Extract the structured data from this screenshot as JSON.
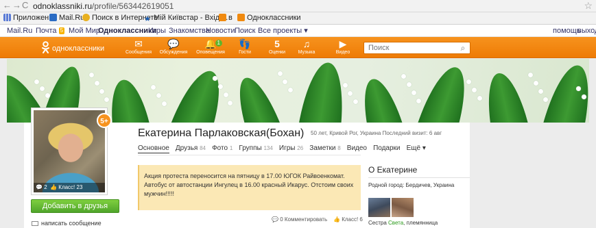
{
  "browser": {
    "back": "←",
    "forward": "→",
    "reload": "C",
    "url_host": "odnoklassniki.ru",
    "url_path": "/profile/563442619051",
    "star": "☆"
  },
  "bookmarks": [
    {
      "label": "Приложения",
      "color": "#5a7bd6"
    },
    {
      "label": "Mail.Ru",
      "color": "#2b6cc4"
    },
    {
      "label": "Поиск в Интернете",
      "color": "#e8b020"
    },
    {
      "label": "Мій Київстар - Вхід ...",
      "color": "#1a5fb4"
    },
    {
      "label": "в",
      "color": "#f08a10"
    },
    {
      "label": "Одноклассники",
      "color": "#f08a10"
    }
  ],
  "portal": {
    "links": [
      "Mail.Ru",
      "Почта",
      "Мой Мир",
      "Одноклассники",
      "Игры",
      "Знакомства",
      "Новости",
      "Поиск",
      "Все проекты ▾"
    ],
    "mail_count": "5",
    "help": "помощь",
    "logout": "выход"
  },
  "toolbar": {
    "logo_text": "одноклассники",
    "items": [
      {
        "label": "Сообщения",
        "icon": "envelope-icon",
        "glyph": "✉"
      },
      {
        "label": "Обсуждения",
        "icon": "chat-icon",
        "glyph": "💬"
      },
      {
        "label": "Оповещения",
        "icon": "bell-icon",
        "glyph": "🔔",
        "badge": "1"
      },
      {
        "label": "Гости",
        "icon": "footprints-icon",
        "glyph": "👣"
      },
      {
        "label": "Оценки",
        "icon": "rating-icon",
        "glyph": "5"
      },
      {
        "label": "Музыка",
        "icon": "music-icon",
        "glyph": "♫"
      },
      {
        "label": "Видео",
        "icon": "video-icon",
        "glyph": "▶"
      }
    ],
    "search_placeholder": "Поиск"
  },
  "colors": {
    "accent": "#f7931e",
    "green": "#5fb52b",
    "notice_bg": "#fbe8b5"
  },
  "profile": {
    "name": "Екатерина Парлаковская(Бохан)",
    "meta": "50 лет, Кривой Рог, Украина  Последний визит: 6 авг",
    "photo_comments": "2",
    "photo_likes": "Класс! 23",
    "badge": "5+",
    "add_friend": "Добавить в друзья",
    "write_message": "написать сообщение"
  },
  "tabs": [
    {
      "label": "Основное",
      "count": ""
    },
    {
      "label": "Друзья",
      "count": "84"
    },
    {
      "label": "Фото",
      "count": "1"
    },
    {
      "label": "Группы",
      "count": "134"
    },
    {
      "label": "Игры",
      "count": "26"
    },
    {
      "label": "Заметки",
      "count": "8"
    },
    {
      "label": "Видео",
      "count": ""
    },
    {
      "label": "Подарки",
      "count": ""
    },
    {
      "label": "Ещё ▾",
      "count": ""
    }
  ],
  "notice": {
    "text": "Акция протеста переносится на  пятницу  в 17.00  ЮГОК Райвоенкомат. Автобус от автостанции Ингулец в 16.00 красный Икарус. Отстоим своих мужчин!!!!!",
    "comments": "0 Комментировать",
    "likes": "Класс! 6"
  },
  "about": {
    "title": "О Екатерине",
    "city": "Родной город: Бердичев, Украина",
    "relative_prefix": "Сестра ",
    "relative_name": "Света",
    "relative_suffix": ", племянница"
  }
}
